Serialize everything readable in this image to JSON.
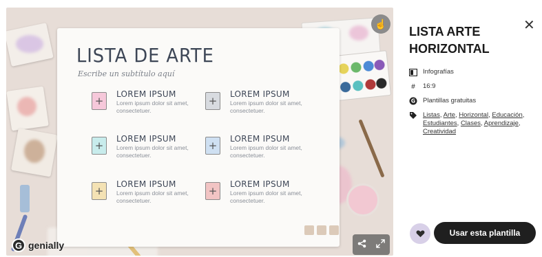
{
  "preview": {
    "title": "LISTA DE ARTE",
    "subtitle": "Escribe un subtítulo aquí",
    "items": [
      {
        "heading": "LOREM IPSUM",
        "text": "Lorem ipsum dolor sit amet, consectetuer.",
        "color": "#e07aa0"
      },
      {
        "heading": "LOREM IPSUM",
        "text": "Lorem ipsum dolor sit amet, consectetuer.",
        "color": "#9aa0a8"
      },
      {
        "heading": "LOREM IPSUM",
        "text": "Lorem ipsum dolor sit amet, consectetuer.",
        "color": "#7cc6c8"
      },
      {
        "heading": "LOREM IPSUM",
        "text": "Lorem ipsum dolor sit amet, consectetuer.",
        "color": "#8fb8e0"
      },
      {
        "heading": "LOREM IPSUM",
        "text": "Lorem ipsum dolor sit amet, consectetuer.",
        "color": "#e8c26a"
      },
      {
        "heading": "LOREM IPSUM",
        "text": "Lorem ipsum dolor sit amet, consectetuer.",
        "color": "#e07a7a"
      }
    ],
    "brand": "genially"
  },
  "panel": {
    "title": "LISTA ARTE HORIZONTAL",
    "category": "Infografías",
    "ratio": "16:9",
    "plan": "Plantillas gratuitas",
    "tags": [
      "Listas",
      "Arte",
      "Horizontal",
      "Educación",
      "Estudiantes",
      "Clases",
      "Aprendizaje",
      "Creatividad"
    ],
    "use_button": "Usar esta plantilla"
  },
  "icons": {
    "close": "close-icon",
    "heart": "heart-icon",
    "share": "share-icon",
    "fullscreen": "fullscreen-icon",
    "touch": "touch-icon"
  }
}
